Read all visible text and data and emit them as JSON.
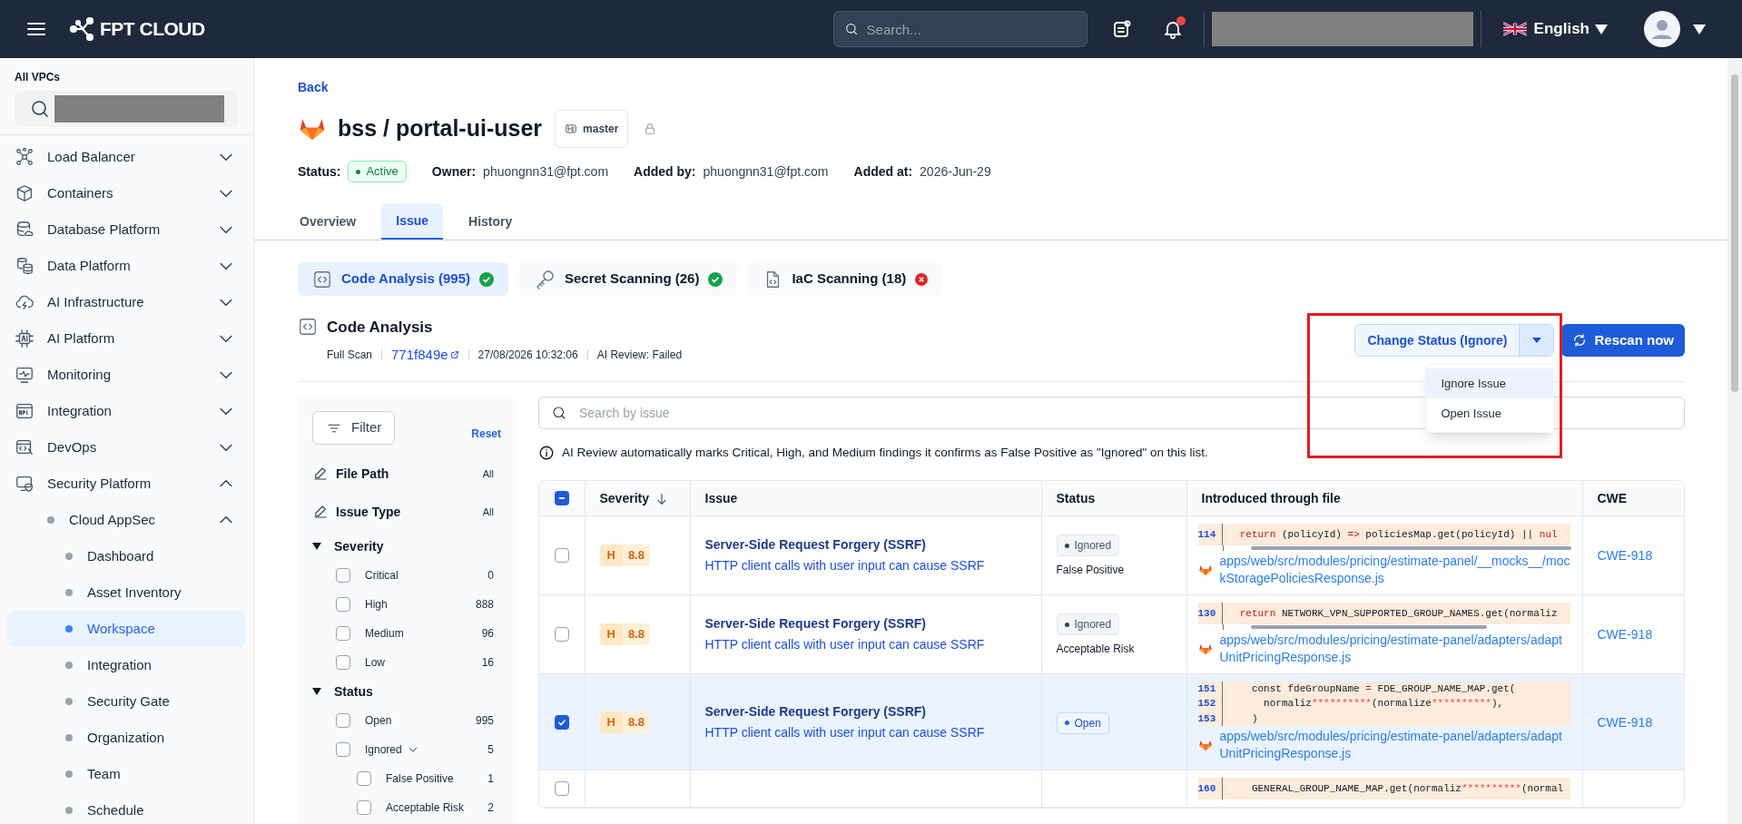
{
  "header": {
    "logo": "FPT CLOUD",
    "search": {
      "placeholder": "Search..."
    },
    "has_notification": true,
    "language": "English"
  },
  "sidebar": {
    "title": "All VPCs",
    "items": [
      {
        "label": "Load Balancer",
        "expanded": false
      },
      {
        "label": "Containers",
        "expanded": false
      },
      {
        "label": "Database Platform",
        "expanded": false
      },
      {
        "label": "Data Platform",
        "expanded": false
      },
      {
        "label": "AI Infrastructure",
        "expanded": false
      },
      {
        "label": "AI Platform",
        "expanded": false
      },
      {
        "label": "Monitoring",
        "expanded": false
      },
      {
        "label": "Integration",
        "expanded": false
      },
      {
        "label": "DevOps",
        "expanded": false
      },
      {
        "label": "Security Platform",
        "expanded": true,
        "children": [
          {
            "label": "Cloud AppSec",
            "expanded": true,
            "children": [
              {
                "label": "Dashboard",
                "selected": false
              },
              {
                "label": "Asset Inventory",
                "selected": false
              },
              {
                "label": "Workspace",
                "selected": true
              },
              {
                "label": "Integration",
                "selected": false
              },
              {
                "label": "Security Gate",
                "selected": false
              },
              {
                "label": "Organization",
                "selected": false
              },
              {
                "label": "Team",
                "selected": false
              },
              {
                "label": "Schedule",
                "selected": false
              }
            ]
          }
        ]
      }
    ]
  },
  "back": "Back",
  "repo": {
    "title": "bss / portal-ui-user",
    "branch": "master"
  },
  "meta": [
    {
      "label": "Status:",
      "value": "Active",
      "kind": "badge"
    },
    {
      "label": "Owner:",
      "value": "phuongnn31@fpt.com",
      "kind": "text"
    },
    {
      "label": "Added by:",
      "value": "phuongnn31@fpt.com",
      "kind": "text"
    },
    {
      "label": "Added at:",
      "value": "2026-Jun-29",
      "kind": "text"
    }
  ],
  "tabs": [
    {
      "label": "Overview",
      "selected": false
    },
    {
      "label": "Issue",
      "selected": true
    },
    {
      "label": "History",
      "selected": false
    }
  ],
  "scan_tabs": [
    {
      "label": "Code Analysis (995)",
      "selected": true,
      "passed": true
    },
    {
      "label": "Secret Scanning (26)",
      "selected": false,
      "passed": true
    },
    {
      "label": "IaC Scanning (18)",
      "selected": false,
      "passed": false
    }
  ],
  "section": {
    "title": "Code Analysis",
    "scan_type": "Full Scan",
    "commit": "771f849e",
    "timestamp": "27/08/2026 10:32:06",
    "ai_review": "AI Review: Failed"
  },
  "actions": {
    "change_status": "Change Status (Ignore)",
    "menu_open": true,
    "menu": [
      {
        "label": "Ignore Issue",
        "highlighted": true
      },
      {
        "label": "Open Issue",
        "highlighted": false
      }
    ],
    "rescan": "Rescan now"
  },
  "filter": {
    "button": "Filter",
    "reset": "Reset",
    "fields": [
      {
        "label": "File Path",
        "value": "All"
      },
      {
        "label": "Issue Type",
        "value": "All"
      }
    ],
    "groups": [
      {
        "label": "Severity",
        "expanded": true,
        "options": [
          {
            "label": "Critical",
            "count": "0",
            "checked": false
          },
          {
            "label": "High",
            "count": "888",
            "checked": false
          },
          {
            "label": "Medium",
            "count": "96",
            "checked": false
          },
          {
            "label": "Low",
            "count": "16",
            "checked": false
          }
        ]
      },
      {
        "label": "Status",
        "expanded": true,
        "options": [
          {
            "label": "Open",
            "count": "995",
            "checked": false
          },
          {
            "label": "Ignored",
            "count": "5",
            "checked": false,
            "expanded": true,
            "children": [
              {
                "label": "False Positive",
                "count": "1",
                "checked": false
              },
              {
                "label": "Acceptable Risk",
                "count": "2",
                "checked": false
              }
            ]
          }
        ]
      }
    ]
  },
  "search": {
    "placeholder": "Search by issue"
  },
  "notice": "AI Review automatically marks Critical, High, and Medium findings it confirms as False Positive as \"Ignored\" on this list.",
  "table": {
    "select_all_indeterminate": true,
    "columns": [
      {
        "label": "Severity",
        "sorted": true
      },
      {
        "label": "Issue",
        "sorted": false
      },
      {
        "label": "Status",
        "sorted": false
      },
      {
        "label": "Introduced through file",
        "sorted": false
      },
      {
        "label": "CWE",
        "sorted": false
      }
    ],
    "rows": [
      {
        "selected": false,
        "severity": {
          "letter": "H",
          "score": "8.8"
        },
        "title": "Server-Side Request Forgery (SSRF)",
        "description": "HTTP client calls with user input can cause SSRF",
        "status": {
          "label": "Ignored",
          "kind": "ignored"
        },
        "reason": "False Positive",
        "code_scrollable": true,
        "code": [
          {
            "line": "114",
            "tokens": [
              {
                "text": "  return",
                "kind": "keyword"
              },
              {
                "text": " (policyId) ",
                "kind": "plain"
              },
              {
                "text": "=>",
                "kind": "keyword"
              },
              {
                "text": " policiesMap.get(policyId) || ",
                "kind": "plain"
              },
              {
                "text": "nul",
                "kind": "keyword"
              }
            ]
          }
        ],
        "file": "apps/web/src/modules/pricing/estimate-panel/__mocks__/mockStoragePoliciesResponse.js",
        "cwe": "CWE-918"
      },
      {
        "selected": false,
        "severity": {
          "letter": "H",
          "score": "8.8"
        },
        "title": "Server-Side Request Forgery (SSRF)",
        "description": "HTTP client calls with user input can cause SSRF",
        "status": {
          "label": "Ignored",
          "kind": "ignored"
        },
        "reason": "Acceptable Risk",
        "code_scrollable": true,
        "code": [
          {
            "line": "130",
            "tokens": [
              {
                "text": "  return",
                "kind": "keyword"
              },
              {
                "text": " NETWORK_VPN_SUPPORTED_GROUP_NAMES.get(normaliz",
                "kind": "plain"
              }
            ]
          }
        ],
        "file": "apps/web/src/modules/pricing/estimate-panel/adapters/adaptUnitPricingResponse.js",
        "cwe": "CWE-918"
      },
      {
        "selected": true,
        "severity": {
          "letter": "H",
          "score": "8.8"
        },
        "title": "Server-Side Request Forgery (SSRF)",
        "description": "HTTP client calls with user input can cause SSRF",
        "status": {
          "label": "Open",
          "kind": "open"
        },
        "code_scrollable": false,
        "code": [
          {
            "line": "151",
            "tokens": [
              {
                "text": "    const fdeGroupName ",
                "kind": "plain"
              },
              {
                "text": "=",
                "kind": "keyword"
              },
              {
                "text": " FDE_GROUP_NAME_MAP.get(",
                "kind": "plain"
              }
            ]
          },
          {
            "line": "152",
            "tokens": [
              {
                "text": "      normaliz",
                "kind": "plain"
              },
              {
                "text": "**********",
                "kind": "mask"
              },
              {
                "text": "(normalize",
                "kind": "plain"
              },
              {
                "text": "**********",
                "kind": "mask"
              },
              {
                "text": "),",
                "kind": "plain"
              }
            ]
          },
          {
            "line": "153",
            "tokens": [
              {
                "text": "    )",
                "kind": "plain"
              }
            ]
          }
        ],
        "file": "apps/web/src/modules/pricing/estimate-panel/adapters/adaptUnitPricingResponse.js",
        "cwe": "CWE-918"
      },
      {
        "selected": false,
        "code_scrollable": false,
        "code": [
          {
            "line": "160",
            "tokens": [
              {
                "text": "    GENERAL_GROUP_NAME_MAP.get(normaliz",
                "kind": "plain"
              },
              {
                "text": "**********",
                "kind": "mask"
              },
              {
                "text": "(normal",
                "kind": "plain"
              }
            ]
          }
        ]
      }
    ]
  }
}
